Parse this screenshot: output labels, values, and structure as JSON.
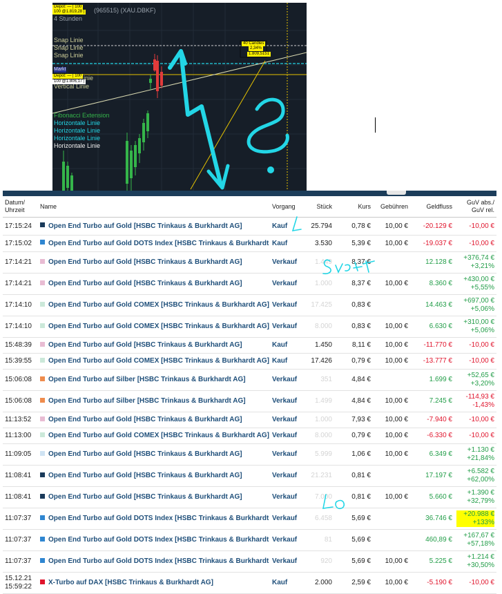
{
  "chart": {
    "info": {
      "depot_tag": "Depot: — | 100",
      "position_line": "100 @1.819,28 |",
      "symbol": "(965515) (XAU.DBKF)",
      "timeframe": "4 Stunden"
    },
    "drawing_labels": [
      {
        "text": "Snap Linie",
        "color": "#cfcf9a"
      },
      {
        "text": "Snap Linie",
        "color": "#cfcf9a"
      },
      {
        "text": "Snap Linie",
        "color": "#cfcf9a"
      }
    ],
    "mid_labels": {
      "markt": "Markt",
      "depot_tag2": "Depot: — | 100",
      "position_line2": "100 @1.806,17 |",
      "linie": "Linie",
      "vertical": "Vertical Linie"
    },
    "fib_label": "Fibonacci Extension",
    "horizontal_labels": [
      "Horizontale Linie",
      "Horizontale Linie",
      "Horizontale Linie",
      "Horizontale Linie"
    ],
    "measure_box": [
      "40 Candles",
      "2,34%",
      "1.809,5151"
    ],
    "colors": {
      "up": "#35b54a",
      "down": "#e23b3b",
      "cyan": "#23d6e6",
      "yellow": "#e6c300",
      "background": "#161e28"
    }
  },
  "table": {
    "headers": {
      "datum": "Datum/ Uhrzeit",
      "name": "Name",
      "vorgang": "Vorgang",
      "stueck": "Stück",
      "kurs": "Kurs",
      "gebuehren": "Gebühren",
      "geldfluss": "Geldfluss",
      "guv": "GuV abs./ GuV rel."
    },
    "rows": [
      {
        "dt": "17:15:24",
        "color": "#1a3a5a",
        "name": "Open End Turbo auf Gold [HSBC Trinkaus & Burkhardt AG]",
        "vorgang": "Kauf",
        "stueck": "25.794",
        "stueck_faint": false,
        "kurs": "0,78 €",
        "gebuehren": "10,00 €",
        "geldfluss": "-20.129 €",
        "gf_sign": "neg",
        "guv_abs": "-10,00 €",
        "guv_rel": "",
        "guv_sign": "neg",
        "h": 26
      },
      {
        "dt": "17:15:02",
        "color": "#2f86d1",
        "name": "Open End Turbo auf Gold DOTS Index [HSBC Trinkaus & Burkhardt AG]",
        "vorgang": "Kauf",
        "stueck": "3.530",
        "stueck_faint": false,
        "kurs": "5,39 €",
        "gebuehren": "10,00 €",
        "geldfluss": "-19.037 €",
        "gf_sign": "neg",
        "guv_abs": "-10,00 €",
        "guv_rel": "",
        "guv_sign": "neg",
        "h": 24
      },
      {
        "dt": "17:14:21",
        "color": "#e8bcd3",
        "name": "Open End Turbo auf Gold [HSBC Trinkaus & Burkhardt AG]",
        "vorgang": "Verkauf",
        "stueck": "1.449",
        "stueck_faint": true,
        "kurs": "8,37 €",
        "gebuehren": "",
        "geldfluss": "12.128 €",
        "gf_sign": "pos",
        "guv_abs": "+376,74 €",
        "guv_rel": "+3,21%",
        "guv_sign": "pos",
        "h": 31
      },
      {
        "dt": "17:14:21",
        "color": "#e8bcd3",
        "name": "Open End Turbo auf Gold [HSBC Trinkaus & Burkhardt AG]",
        "vorgang": "Verkauf",
        "stueck": "1.000",
        "stueck_faint": true,
        "kurs": "8,37 €",
        "gebuehren": "10,00 €",
        "geldfluss": "8.360 €",
        "gf_sign": "pos",
        "guv_abs": "+430,00 €",
        "guv_rel": "+5,55%",
        "guv_sign": "pos",
        "h": 31
      },
      {
        "dt": "17:14:10",
        "color": "#cbe8d9",
        "name": "Open End Turbo auf Gold COMEX [HSBC Trinkaus & Burkhardt AG]",
        "vorgang": "Verkauf",
        "stueck": "17.425",
        "stueck_faint": true,
        "kurs": "0,83 €",
        "gebuehren": "",
        "geldfluss": "14.463 €",
        "gf_sign": "pos",
        "guv_abs": "+697,00 €",
        "guv_rel": "+5,06%",
        "guv_sign": "pos",
        "h": 31
      },
      {
        "dt": "17:14:10",
        "color": "#cbe8d9",
        "name": "Open End Turbo auf Gold COMEX [HSBC Trinkaus & Burkhardt AG]",
        "vorgang": "Verkauf",
        "stueck": "8.000",
        "stueck_faint": true,
        "kurs": "0,83 €",
        "gebuehren": "10,00 €",
        "geldfluss": "6.630 €",
        "gf_sign": "pos",
        "guv_abs": "+310,00 €",
        "guv_rel": "+5,06%",
        "guv_sign": "pos",
        "h": 31
      },
      {
        "dt": "15:48:39",
        "color": "#e8bcd3",
        "name": "Open End Turbo auf Gold [HSBC Trinkaus & Burkhardt AG]",
        "vorgang": "Kauf",
        "stueck": "1.450",
        "stueck_faint": false,
        "kurs": "8,11 €",
        "gebuehren": "10,00 €",
        "geldfluss": "-11.770 €",
        "gf_sign": "neg",
        "guv_abs": "-10,00 €",
        "guv_rel": "",
        "guv_sign": "neg",
        "h": 23
      },
      {
        "dt": "15:39:55",
        "color": "#cbe8d9",
        "name": "Open End Turbo auf Gold COMEX [HSBC Trinkaus & Burkhardt AG]",
        "vorgang": "Kauf",
        "stueck": "17.426",
        "stueck_faint": false,
        "kurs": "0,79 €",
        "gebuehren": "10,00 €",
        "geldfluss": "-13.777 €",
        "gf_sign": "neg",
        "guv_abs": "-10,00 €",
        "guv_rel": "",
        "guv_sign": "neg",
        "h": 23
      },
      {
        "dt": "15:06:08",
        "color": "#ef8c4d",
        "name": "Open End Turbo auf Silber [HSBC Trinkaus & Burkhardt AG]",
        "vorgang": "Verkauf",
        "stueck": "351",
        "stueck_faint": true,
        "kurs": "4,84 €",
        "gebuehren": "",
        "geldfluss": "1.699 €",
        "gf_sign": "pos",
        "guv_abs": "+52,65 €",
        "guv_rel": "+3,20%",
        "guv_sign": "pos",
        "h": 31
      },
      {
        "dt": "15:06:08",
        "color": "#ef8c4d",
        "name": "Open End Turbo auf Silber [HSBC Trinkaus & Burkhardt AG]",
        "vorgang": "Verkauf",
        "stueck": "1.499",
        "stueck_faint": true,
        "kurs": "4,84 €",
        "gebuehren": "10,00 €",
        "geldfluss": "7.245 €",
        "gf_sign": "pos",
        "guv_abs": "-114,93 €",
        "guv_rel": "-1,43%",
        "guv_sign": "neg",
        "h": 31
      },
      {
        "dt": "11:13:52",
        "color": "#e8bcd3",
        "name": "Open End Turbo auf Gold [HSBC Trinkaus & Burkhardt AG]",
        "vorgang": "Verkauf",
        "stueck": "1.000",
        "stueck_faint": true,
        "kurs": "7,93 €",
        "gebuehren": "10,00 €",
        "geldfluss": "-7.940 €",
        "gf_sign": "neg",
        "guv_abs": "-10,00 €",
        "guv_rel": "",
        "guv_sign": "neg",
        "h": 23
      },
      {
        "dt": "11:13:00",
        "color": "#cbe8d9",
        "name": "Open End Turbo auf Gold COMEX [HSBC Trinkaus & Burkhardt AG]",
        "vorgang": "Verkauf",
        "stueck": "8.000",
        "stueck_faint": true,
        "kurs": "0,79 €",
        "gebuehren": "10,00 €",
        "geldfluss": "-6.330 €",
        "gf_sign": "neg",
        "guv_abs": "-10,00 €",
        "guv_rel": "",
        "guv_sign": "neg",
        "h": 23
      },
      {
        "dt": "11:09:05",
        "color": "#cfe3f3",
        "name": "Open End Turbo auf Gold [HSBC Trinkaus & Burkhardt AG]",
        "vorgang": "Verkauf",
        "stueck": "5.999",
        "stueck_faint": true,
        "kurs": "1,06 €",
        "gebuehren": "10,00 €",
        "geldfluss": "6.349 €",
        "gf_sign": "pos",
        "guv_abs": "+1.130 €",
        "guv_rel": "+21,84%",
        "guv_sign": "pos",
        "h": 31
      },
      {
        "dt": "11:08:41",
        "color": "#1a3a5a",
        "name": "Open End Turbo auf Gold [HSBC Trinkaus & Burkhardt AG]",
        "vorgang": "Verkauf",
        "stueck": "21.231",
        "stueck_faint": true,
        "kurs": "0,81 €",
        "gebuehren": "",
        "geldfluss": "17.197 €",
        "gf_sign": "pos",
        "guv_abs": "+6.582 €",
        "guv_rel": "+62,00%",
        "guv_sign": "pos",
        "h": 31
      },
      {
        "dt": "11:08:41",
        "color": "#1a3a5a",
        "name": "Open End Turbo auf Gold [HSBC Trinkaus & Burkhardt AG]",
        "vorgang": "Verkauf",
        "stueck": "7.000",
        "stueck_faint": true,
        "kurs": "0,81 €",
        "gebuehren": "10,00 €",
        "geldfluss": "5.660 €",
        "gf_sign": "pos",
        "guv_abs": "+1.390 €",
        "guv_rel": "+32,79%",
        "guv_sign": "pos",
        "h": 31
      },
      {
        "dt": "11:07:37",
        "color": "#2f86d1",
        "name": "Open End Turbo auf Gold DOTS Index [HSBC Trinkaus & Burkhardt AG]",
        "vorgang": "Verkauf",
        "stueck": "6.458",
        "stueck_faint": true,
        "kurs": "5,69 €",
        "gebuehren": "",
        "geldfluss": "36.746 €",
        "gf_sign": "pos",
        "guv_abs": "+20.988 €",
        "guv_rel": "+133%",
        "guv_sign": "pos",
        "highlight": true,
        "h": 31
      },
      {
        "dt": "11:07:37",
        "color": "#2f86d1",
        "name": "Open End Turbo auf Gold DOTS Index [HSBC Trinkaus & Burkhardt AG]",
        "vorgang": "Verkauf",
        "stueck": "81",
        "stueck_faint": true,
        "kurs": "5,69 €",
        "gebuehren": "",
        "geldfluss": "460,89 €",
        "gf_sign": "pos",
        "guv_abs": "+167,67 €",
        "guv_rel": "+57,18%",
        "guv_sign": "pos",
        "h": 31
      },
      {
        "dt": "11:07:37",
        "color": "#2f86d1",
        "name": "Open End Turbo auf Gold DOTS Index [HSBC Trinkaus & Burkhardt AG]",
        "vorgang": "Verkauf",
        "stueck": "920",
        "stueck_faint": true,
        "kurs": "5,69 €",
        "gebuehren": "10,00 €",
        "geldfluss": "5.225 €",
        "gf_sign": "pos",
        "guv_abs": "+1.214 €",
        "guv_rel": "+30,50%",
        "guv_sign": "pos",
        "h": 31
      },
      {
        "dt": "15.12.21 15:59:22",
        "color": "#e0142c",
        "name": "X-Turbo auf DAX [HSBC Trinkaus & Burkhardt AG]",
        "vorgang": "Kauf",
        "stueck": "2.000",
        "stueck_faint": false,
        "kurs": "2,59 €",
        "gebuehren": "10,00 €",
        "geldfluss": "-5.190 €",
        "gf_sign": "neg",
        "guv_abs": "-10,00 €",
        "guv_rel": "",
        "guv_sign": "neg",
        "h": 31
      }
    ]
  },
  "annotations": {
    "question_mark": "?",
    "short_word": "Short",
    "l_mark": "L",
    "lo_mark": "Lo"
  }
}
